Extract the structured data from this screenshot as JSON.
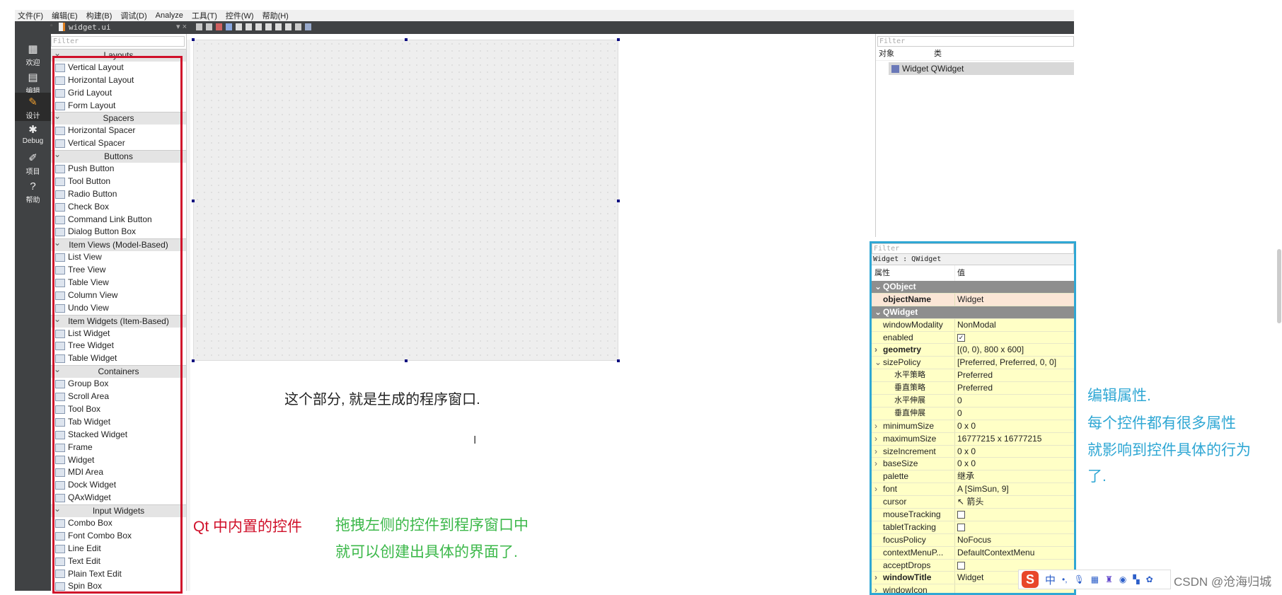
{
  "menu": [
    "文件(F)",
    "编辑(E)",
    "构建(B)",
    "调试(D)",
    "Analyze",
    "工具(T)",
    "控件(W)",
    "帮助(H)"
  ],
  "tab": {
    "file": "widget.ui"
  },
  "nav": [
    {
      "label": "欢迎",
      "icon": "grid-icon"
    },
    {
      "label": "编辑",
      "icon": "document-icon"
    },
    {
      "label": "设计",
      "icon": "pencil-icon",
      "active": true
    },
    {
      "label": "Debug",
      "icon": "bug-icon"
    },
    {
      "label": "项目",
      "icon": "wrench-icon"
    },
    {
      "label": "帮助",
      "icon": "help-icon"
    }
  ],
  "widget_box": {
    "filter_placeholder": "Filter",
    "groups": [
      {
        "title": "Layouts",
        "items": [
          "Vertical Layout",
          "Horizontal Layout",
          "Grid Layout",
          "Form Layout"
        ]
      },
      {
        "title": "Spacers",
        "items": [
          "Horizontal Spacer",
          "Vertical Spacer"
        ]
      },
      {
        "title": "Buttons",
        "items": [
          "Push Button",
          "Tool Button",
          "Radio Button",
          "Check Box",
          "Command Link Button",
          "Dialog Button Box"
        ]
      },
      {
        "title": "Item Views (Model-Based)",
        "items": [
          "List View",
          "Tree View",
          "Table View",
          "Column View",
          "Undo View"
        ]
      },
      {
        "title": "Item Widgets (Item-Based)",
        "items": [
          "List Widget",
          "Tree Widget",
          "Table Widget"
        ]
      },
      {
        "title": "Containers",
        "items": [
          "Group Box",
          "Scroll Area",
          "Tool Box",
          "Tab Widget",
          "Stacked Widget",
          "Frame",
          "Widget",
          "MDI Area",
          "Dock Widget",
          "QAxWidget"
        ]
      },
      {
        "title": "Input Widgets",
        "items": [
          "Combo Box",
          "Font Combo Box",
          "Line Edit",
          "Text Edit",
          "Plain Text Edit",
          "Spin Box"
        ]
      }
    ]
  },
  "object_inspector": {
    "filter_placeholder": "Filter",
    "col_object": "对象",
    "col_class": "类",
    "row": "Widget QWidget"
  },
  "property_editor": {
    "filter_placeholder": "Filter",
    "context": "Widget : QWidget",
    "col_prop": "属性",
    "col_value": "值",
    "rows": [
      {
        "k": "QObject",
        "type": "sec"
      },
      {
        "k": "objectName",
        "v": "Widget",
        "bold": true,
        "hl": true
      },
      {
        "k": "QWidget",
        "type": "sec"
      },
      {
        "k": "windowModality",
        "v": "NonModal"
      },
      {
        "k": "enabled",
        "check": true
      },
      {
        "k": "geometry",
        "v": "[(0, 0), 800 x 600]",
        "bold": true,
        "arrow": "›"
      },
      {
        "k": "sizePolicy",
        "v": "[Preferred, Preferred, 0, 0]",
        "arrow": "⌄"
      },
      {
        "k": "水平策略",
        "v": "Preferred",
        "sub": true
      },
      {
        "k": "垂直策略",
        "v": "Preferred",
        "sub": true
      },
      {
        "k": "水平伸展",
        "v": "0",
        "sub": true
      },
      {
        "k": "垂直伸展",
        "v": "0",
        "sub": true
      },
      {
        "k": "minimumSize",
        "v": "0 x 0",
        "arrow": "›"
      },
      {
        "k": "maximumSize",
        "v": "16777215 x 16777215",
        "arrow": "›"
      },
      {
        "k": "sizeIncrement",
        "v": "0 x 0",
        "arrow": "›"
      },
      {
        "k": "baseSize",
        "v": "0 x 0",
        "arrow": "›"
      },
      {
        "k": "palette",
        "v": "继承"
      },
      {
        "k": "font",
        "v": "A  [SimSun, 9]",
        "arrow": "›"
      },
      {
        "k": "cursor",
        "v": "↖  箭头"
      },
      {
        "k": "mouseTracking",
        "check": false
      },
      {
        "k": "tabletTracking",
        "check": false
      },
      {
        "k": "focusPolicy",
        "v": "NoFocus"
      },
      {
        "k": "contextMenuP...",
        "v": "DefaultContextMenu"
      },
      {
        "k": "acceptDrops",
        "check": false
      },
      {
        "k": "windowTitle",
        "v": "Widget",
        "bold": true,
        "arrow": "›"
      },
      {
        "k": "windowIcon",
        "v": "",
        "arrow": "›"
      }
    ]
  },
  "annotations": {
    "canvas_note": "这个部分, 就是生成的程序窗口.",
    "builtin_note": "Qt 中内置的控件",
    "drag_note_1": "拖拽左侧的控件到程序窗口中",
    "drag_note_2": "就可以创建出具体的界面了.",
    "prop_note_1": "编辑属性.",
    "prop_note_2": "每个控件都有很多属性",
    "prop_note_3": "就影响到控件具体的行为",
    "prop_note_4": "了."
  },
  "watermark": "CSDN @沧海归城",
  "ime": {
    "mode": "中",
    "punct": "•,"
  },
  "colors": {
    "red_note": "#d0102a",
    "green_note": "#3cb84a",
    "blue_note": "#2fa7d4",
    "dark_panel": "#404244"
  }
}
